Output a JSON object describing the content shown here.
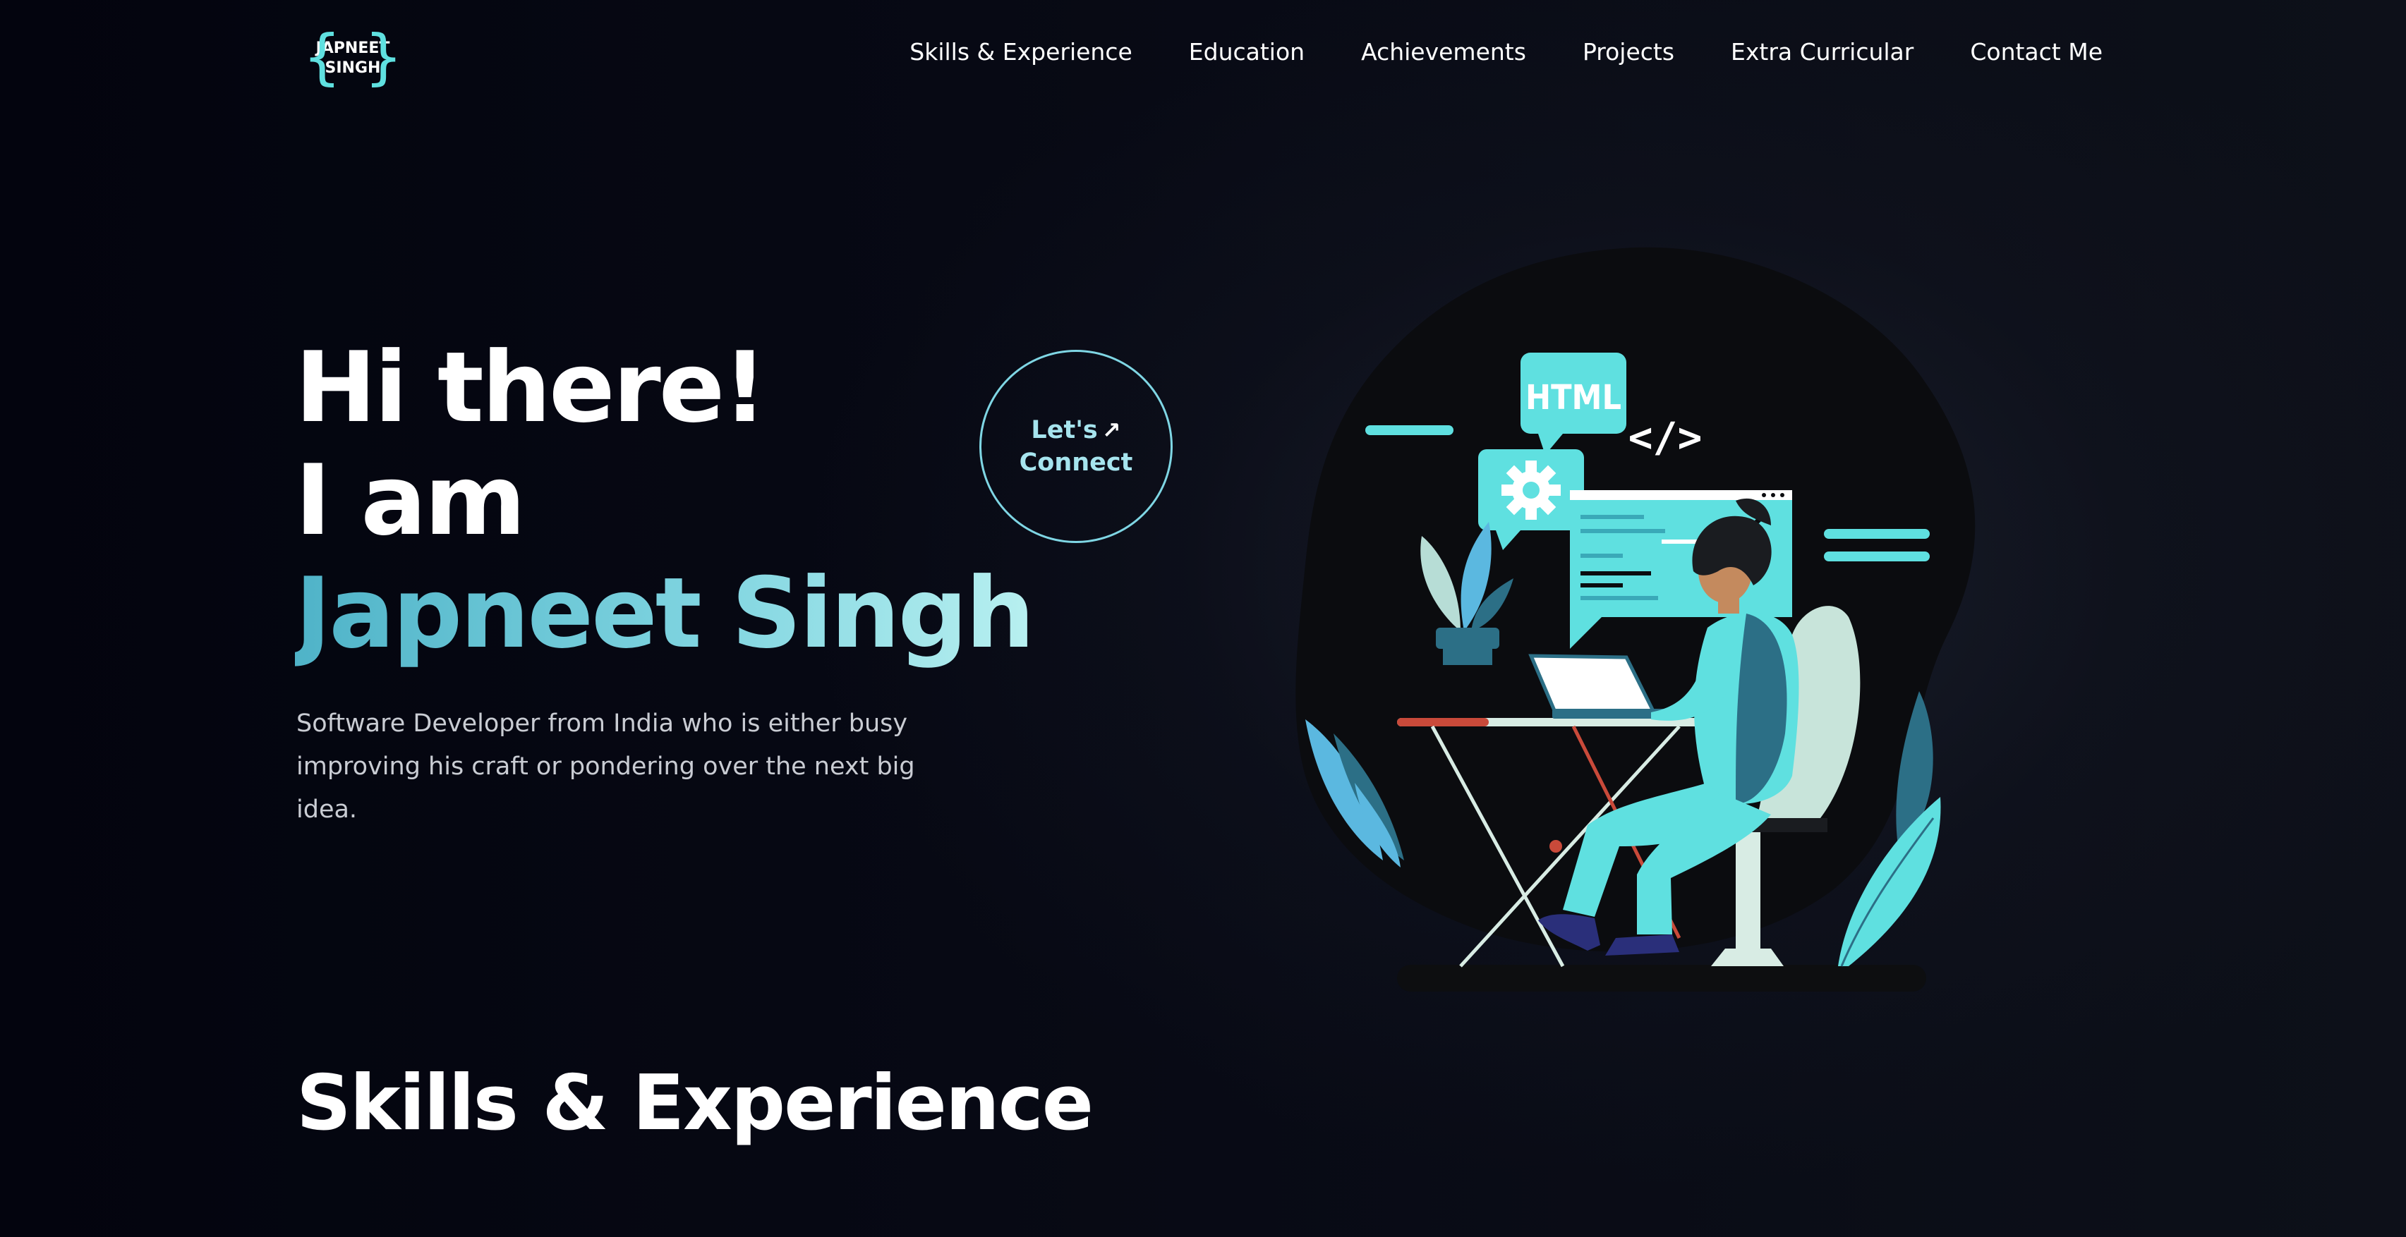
{
  "logo": {
    "line1": "JAPNEET",
    "line2": "SINGH",
    "brace_left": "{",
    "brace_right": "}"
  },
  "nav": {
    "items": [
      {
        "label": "Skills & Experience"
      },
      {
        "label": "Education"
      },
      {
        "label": "Achievements"
      },
      {
        "label": "Projects"
      },
      {
        "label": "Extra Curricular"
      },
      {
        "label": "Contact Me"
      }
    ]
  },
  "hero": {
    "line1": "Hi there!",
    "line2": "I am",
    "name": "Japneet Singh",
    "subtitle": "Software Developer from India who is either busy improving his craft or pondering over the next big idea."
  },
  "connect": {
    "line1": "Let's",
    "arrow": "↗",
    "line2": "Connect"
  },
  "illustration": {
    "html_tag": "HTML",
    "code_icon": "</>",
    "gear_icon": "gear-icon"
  },
  "sections": {
    "skills_title": "Skills & Experience"
  },
  "colors": {
    "background": "#05060f",
    "accent": "#5fe0e0",
    "name_gradient_start": "#4fb3c8",
    "name_gradient_end": "#b8f0f0",
    "subtitle_text": "#c9ccd3"
  }
}
